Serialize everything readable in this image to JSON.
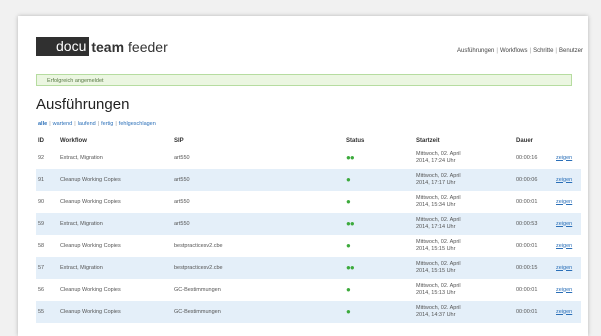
{
  "app": {
    "logo_docu": "docu",
    "logo_team": "team",
    "logo_feeder": "feeder"
  },
  "nav": [
    "Ausführungen",
    "Workflows",
    "Schritte",
    "Benutzer"
  ],
  "alert": "Erfolgreich angemeldet",
  "title": "Ausführungen",
  "filters": [
    "alle",
    "wartend",
    "laufend",
    "fertig",
    "fehlgeschlagen"
  ],
  "columns": {
    "id": "ID",
    "workflow": "Workflow",
    "sip": "SIP",
    "status": "Status",
    "start": "Startzeit",
    "duration": "Dauer"
  },
  "rows": [
    {
      "id": "92",
      "workflow": "Extract, Migration",
      "sip": "art550",
      "status": "●●",
      "start1": "Mittwoch, 02. April",
      "start2": "2014, 17:24 Uhr",
      "duration": "00:00:16",
      "action": "zeigen"
    },
    {
      "id": "91",
      "workflow": "Cleanup Working Copies",
      "sip": "art550",
      "status": "●",
      "start1": "Mittwoch, 02. April",
      "start2": "2014, 17:17 Uhr",
      "duration": "00:00:06",
      "action": "zeigen"
    },
    {
      "id": "90",
      "workflow": "Cleanup Working Copies",
      "sip": "art550",
      "status": "●",
      "start1": "Mittwoch, 02. April",
      "start2": "2014, 15:34 Uhr",
      "duration": "00:00:01",
      "action": "zeigen"
    },
    {
      "id": "59",
      "workflow": "Extract, Migration",
      "sip": "art550",
      "status": "●●",
      "start1": "Mittwoch, 02. April",
      "start2": "2014, 17:14 Uhr",
      "duration": "00:00:53",
      "action": "zeigen"
    },
    {
      "id": "58",
      "workflow": "Cleanup Working Copies",
      "sip": "bestpracticesv2.cbe",
      "status": "●",
      "start1": "Mittwoch, 02. April",
      "start2": "2014, 15:15 Uhr",
      "duration": "00:00:01",
      "action": "zeigen"
    },
    {
      "id": "57",
      "workflow": "Extract, Migration",
      "sip": "bestpracticesv2.cbe",
      "status": "●●",
      "start1": "Mittwoch, 02. April",
      "start2": "2014, 15:15 Uhr",
      "duration": "00:00:15",
      "action": "zeigen"
    },
    {
      "id": "56",
      "workflow": "Cleanup Working Copies",
      "sip": "GC-Bestimmungen",
      "status": "●",
      "start1": "Mittwoch, 02. April",
      "start2": "2014, 15:13 Uhr",
      "duration": "00:00:01",
      "action": "zeigen"
    },
    {
      "id": "55",
      "workflow": "Cleanup Working Copies",
      "sip": "GC-Bestimmungen",
      "status": "●",
      "start1": "Mittwoch, 02. April",
      "start2": "2014, 14:37 Uhr",
      "duration": "00:00:01",
      "action": "zeigen"
    }
  ]
}
